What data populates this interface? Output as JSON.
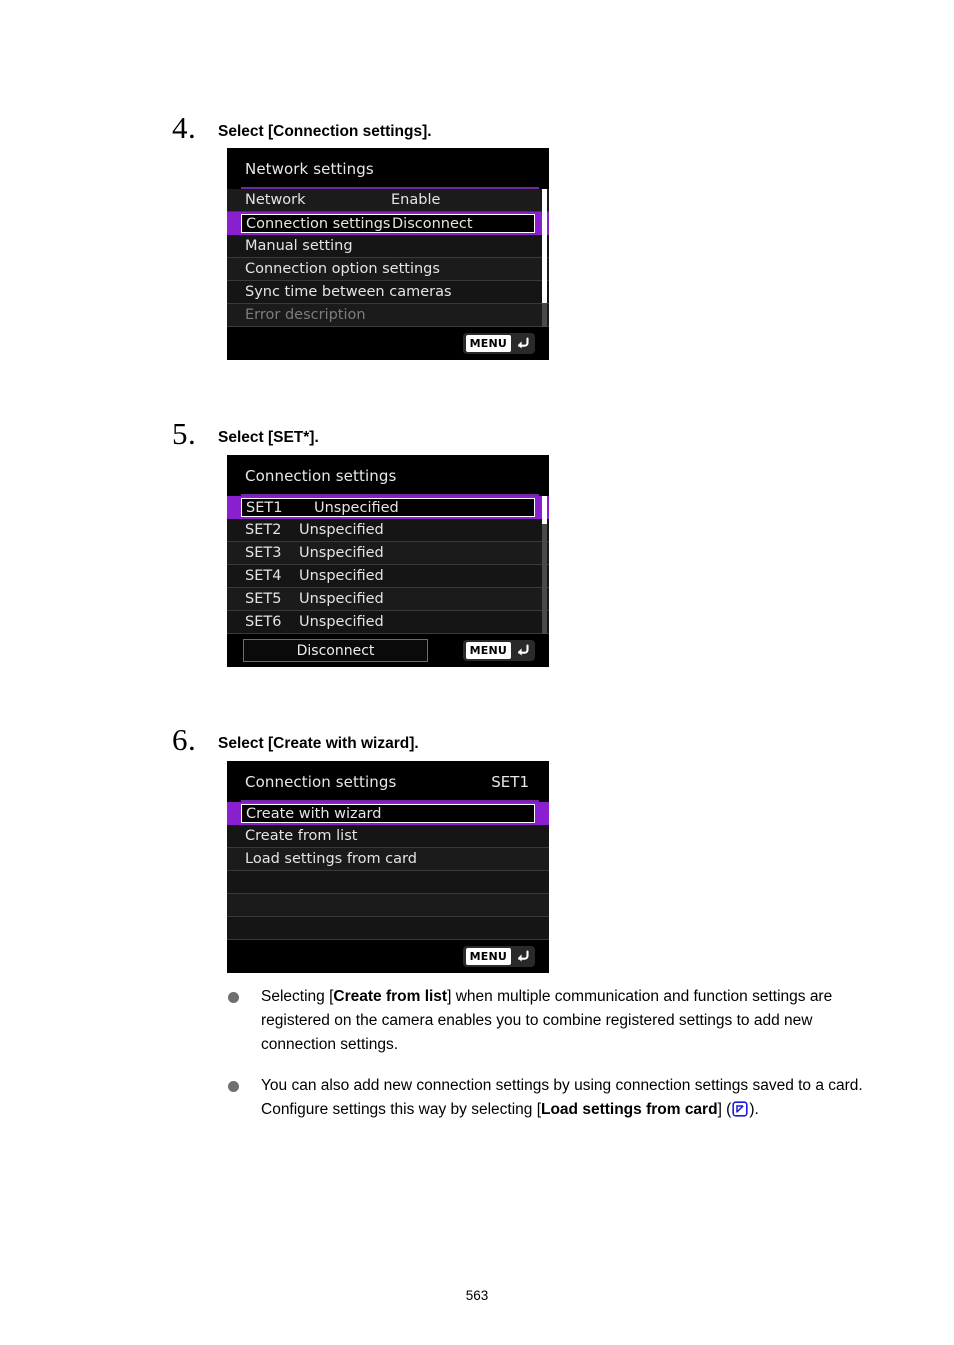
{
  "page": {
    "number": "563",
    "colors": {
      "highlight_purple": "#8a1fd0",
      "title_underline": "#6c2a9c",
      "screen_black": "#000000",
      "row_dark": "#1b1b1b",
      "bullet_gray": "#6f6f6f",
      "ref_icon_blue": "#1a1ae0"
    }
  },
  "steps": [
    {
      "number": "4.",
      "title": "Select [Connection settings].",
      "screen": {
        "title": "Network settings",
        "title_right": "",
        "rows": [
          {
            "label": "Network",
            "value": "Enable",
            "selected": false,
            "disabled": false
          },
          {
            "label": "Connection settings",
            "value": "Disconnect",
            "selected": true,
            "disabled": false
          },
          {
            "label": "Manual setting",
            "value": "",
            "selected": false,
            "disabled": false
          },
          {
            "label": "Connection option settings",
            "value": "",
            "selected": false,
            "disabled": false
          },
          {
            "label": "Sync time between cameras",
            "value": "",
            "selected": false,
            "disabled": false
          },
          {
            "label": "Error description",
            "value": "",
            "selected": false,
            "disabled": true
          }
        ],
        "footer": {
          "menu_label": "MENU",
          "button_label": ""
        },
        "scrollbar": {
          "visible": true
        }
      }
    },
    {
      "number": "5.",
      "title": "Select [SET*].",
      "screen": {
        "title": "Connection settings",
        "title_right": "",
        "rows": [
          {
            "name": "SET1",
            "value": "Unspecified",
            "selected": true
          },
          {
            "name": "SET2",
            "value": "Unspecified",
            "selected": false
          },
          {
            "name": "SET3",
            "value": "Unspecified",
            "selected": false
          },
          {
            "name": "SET4",
            "value": "Unspecified",
            "selected": false
          },
          {
            "name": "SET5",
            "value": "Unspecified",
            "selected": false
          },
          {
            "name": "SET6",
            "value": "Unspecified",
            "selected": false
          }
        ],
        "footer": {
          "menu_label": "MENU",
          "button_label": "Disconnect"
        },
        "scrollbar": {
          "visible": true
        }
      }
    },
    {
      "number": "6.",
      "title": "Select [Create with wizard].",
      "screen": {
        "title": "Connection settings",
        "title_right": "SET1",
        "rows": [
          {
            "label": "Create with wizard",
            "value": "",
            "selected": true,
            "disabled": false
          },
          {
            "label": "Create from list",
            "value": "",
            "selected": false,
            "disabled": false
          },
          {
            "label": "Load settings from card",
            "value": "",
            "selected": false,
            "disabled": false
          },
          {
            "label": "",
            "value": "",
            "selected": false,
            "disabled": false
          },
          {
            "label": "",
            "value": "",
            "selected": false,
            "disabled": false
          },
          {
            "label": "",
            "value": "",
            "selected": false,
            "disabled": false
          }
        ],
        "footer": {
          "menu_label": "MENU",
          "button_label": ""
        },
        "scrollbar": {
          "visible": false
        }
      }
    }
  ],
  "notes": [
    {
      "parts": [
        {
          "t": "Selecting [",
          "b": false
        },
        {
          "t": "Create from list",
          "b": true
        },
        {
          "t": "] when multiple communication and function settings are registered on the camera enables you to combine registered settings to add new connection settings.",
          "b": false
        }
      ]
    },
    {
      "parts": [
        {
          "t": "You can also add new connection settings by using connection settings saved to a card. Configure settings this way by selecting [",
          "b": false
        },
        {
          "t": "Load settings from card",
          "b": true
        },
        {
          "t": "] (",
          "b": false
        },
        {
          "t": "REF_ICON",
          "b": false
        },
        {
          "t": ").",
          "b": false
        }
      ]
    }
  ]
}
